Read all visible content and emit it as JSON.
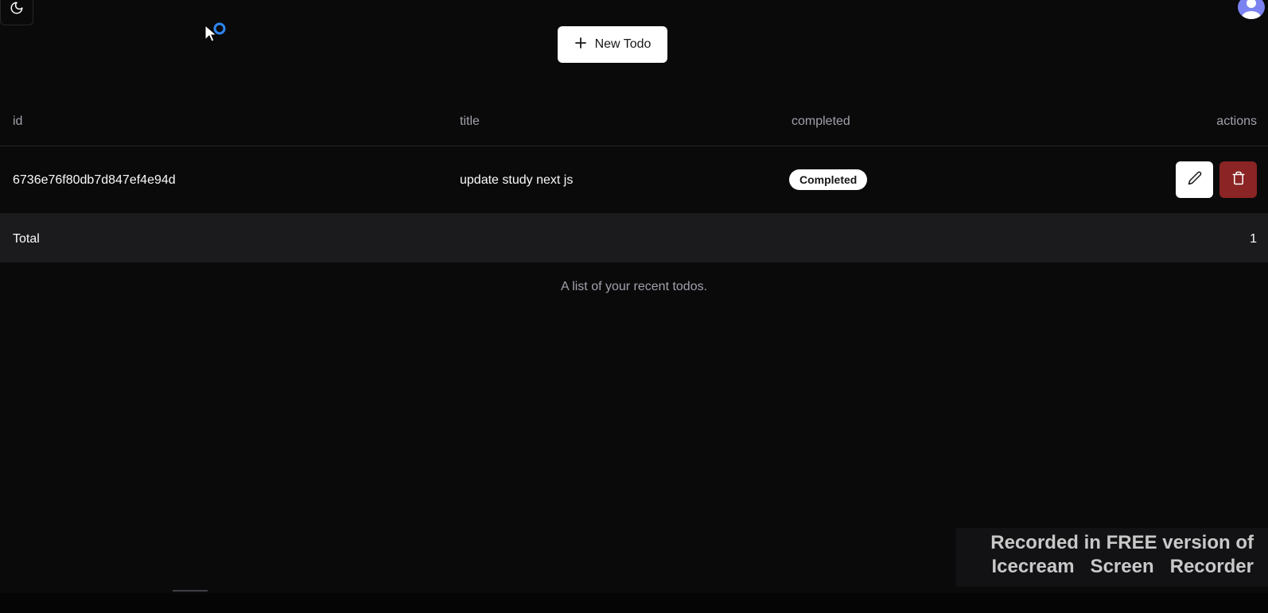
{
  "header": {
    "theme_toggle_icon": "moon-icon",
    "avatar_icon": "user-icon",
    "new_todo_label": "New Todo"
  },
  "table": {
    "columns": [
      "id",
      "title",
      "completed",
      "actions"
    ],
    "rows": [
      {
        "id": "6736e76f80db7d847ef4e94d",
        "title": "update study next js",
        "status": "Completed",
        "actions": [
          "pencil-icon",
          "trash-icon"
        ]
      }
    ],
    "footer": {
      "label": "Total",
      "value": "1"
    },
    "caption": "A list of your recent todos."
  },
  "watermark": {
    "line1": "Recorded in FREE version of",
    "line2": "Icecream   Screen   Recorder"
  },
  "colors": {
    "background": "#0a0a0b",
    "footer_row": "#1b1b1d",
    "delete_button": "#8b2424",
    "avatar": "#7b83f0",
    "muted_text": "#a1a1aa"
  }
}
